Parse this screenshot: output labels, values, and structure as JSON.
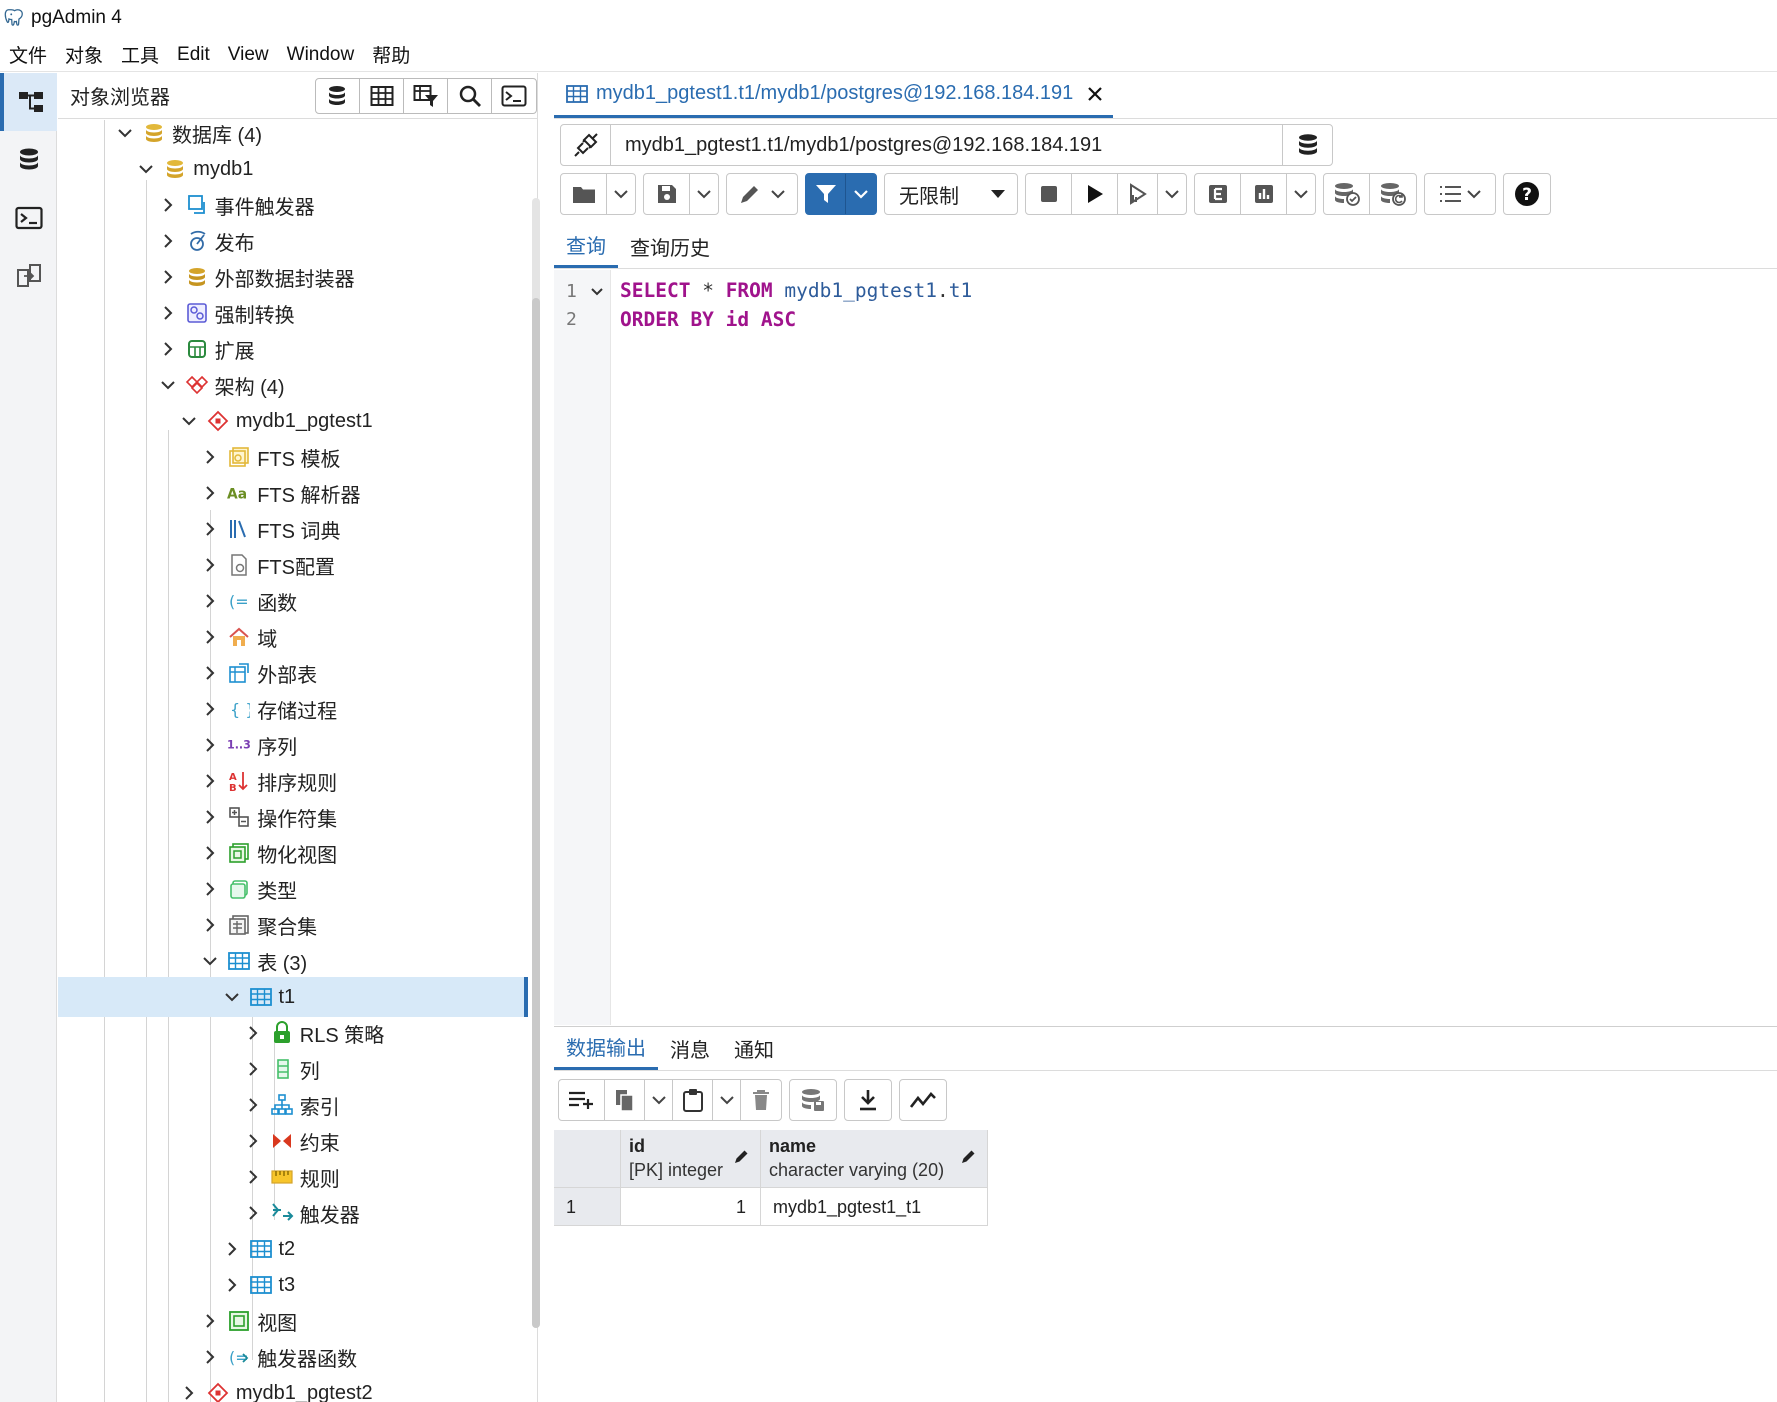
{
  "window": {
    "title": "pgAdmin 4"
  },
  "menubar": [
    "文件",
    "对象",
    "工具",
    "Edit",
    "View",
    "Window",
    "帮助"
  ],
  "browser": {
    "title": "对象浏览器",
    "tree": [
      {
        "label": "数据库 (4)",
        "depth": 0,
        "expanded": true,
        "icon": "database-icon"
      },
      {
        "label": "mydb1",
        "depth": 1,
        "expanded": true,
        "icon": "database-icon"
      },
      {
        "label": "事件触发器",
        "depth": 2,
        "expanded": false,
        "icon": "event-trigger-icon"
      },
      {
        "label": "发布",
        "depth": 2,
        "expanded": false,
        "icon": "publication-icon"
      },
      {
        "label": "外部数据封装器",
        "depth": 2,
        "expanded": false,
        "icon": "fdw-icon"
      },
      {
        "label": "强制转换",
        "depth": 2,
        "expanded": false,
        "icon": "cast-icon"
      },
      {
        "label": "扩展",
        "depth": 2,
        "expanded": false,
        "icon": "extension-icon"
      },
      {
        "label": "架构 (4)",
        "depth": 2,
        "expanded": true,
        "icon": "schemas-icon"
      },
      {
        "label": "mydb1_pgtest1",
        "depth": 3,
        "expanded": true,
        "icon": "schema-icon"
      },
      {
        "label": "FTS 模板",
        "depth": 4,
        "expanded": false,
        "icon": "fts-template-icon"
      },
      {
        "label": "FTS 解析器",
        "depth": 4,
        "expanded": false,
        "icon": "fts-parser-icon"
      },
      {
        "label": "FTS 词典",
        "depth": 4,
        "expanded": false,
        "icon": "fts-dictionary-icon"
      },
      {
        "label": "FTS配置",
        "depth": 4,
        "expanded": false,
        "icon": "fts-config-icon"
      },
      {
        "label": "函数",
        "depth": 4,
        "expanded": false,
        "icon": "function-icon"
      },
      {
        "label": "域",
        "depth": 4,
        "expanded": false,
        "icon": "domain-icon"
      },
      {
        "label": "外部表",
        "depth": 4,
        "expanded": false,
        "icon": "foreign-table-icon"
      },
      {
        "label": "存储过程",
        "depth": 4,
        "expanded": false,
        "icon": "procedure-icon"
      },
      {
        "label": "序列",
        "depth": 4,
        "expanded": false,
        "icon": "sequence-icon"
      },
      {
        "label": "排序规则",
        "depth": 4,
        "expanded": false,
        "icon": "collation-icon"
      },
      {
        "label": "操作符集",
        "depth": 4,
        "expanded": false,
        "icon": "operator-icon"
      },
      {
        "label": "物化视图",
        "depth": 4,
        "expanded": false,
        "icon": "mview-icon"
      },
      {
        "label": "类型",
        "depth": 4,
        "expanded": false,
        "icon": "type-icon"
      },
      {
        "label": "聚合集",
        "depth": 4,
        "expanded": false,
        "icon": "aggregate-icon"
      },
      {
        "label": "表 (3)",
        "depth": 4,
        "expanded": true,
        "icon": "tables-icon"
      },
      {
        "label": "t1",
        "depth": 5,
        "expanded": true,
        "icon": "table-icon",
        "selected": true
      },
      {
        "label": "RLS 策略",
        "depth": 6,
        "expanded": false,
        "icon": "rls-policy-icon"
      },
      {
        "label": "列",
        "depth": 6,
        "expanded": false,
        "icon": "columns-icon"
      },
      {
        "label": "索引",
        "depth": 6,
        "expanded": false,
        "icon": "index-icon"
      },
      {
        "label": "约束",
        "depth": 6,
        "expanded": false,
        "icon": "constraint-icon"
      },
      {
        "label": "规则",
        "depth": 6,
        "expanded": false,
        "icon": "rule-icon"
      },
      {
        "label": "触发器",
        "depth": 6,
        "expanded": false,
        "icon": "trigger-icon"
      },
      {
        "label": "t2",
        "depth": 5,
        "expanded": false,
        "icon": "table-icon"
      },
      {
        "label": "t3",
        "depth": 5,
        "expanded": false,
        "icon": "table-icon"
      },
      {
        "label": "视图",
        "depth": 4,
        "expanded": false,
        "icon": "view-icon"
      },
      {
        "label": "触发器函数",
        "depth": 4,
        "expanded": false,
        "icon": "trigger-function-icon"
      },
      {
        "label": "mydb1_pgtest2",
        "depth": 3,
        "expanded": false,
        "icon": "schema-icon"
      }
    ]
  },
  "query_tab": {
    "label": "mydb1_pgtest1.t1/mydb1/postgres@192.168.184.191",
    "connection": "mydb1_pgtest1.t1/mydb1/postgres@192.168.184.191",
    "limit": "无限制",
    "subtabs": [
      "查询",
      "查询历史"
    ],
    "active_subtab": "查询"
  },
  "editor": {
    "line_numbers": [
      "1",
      "2"
    ],
    "line1": {
      "kw1": "SELECT",
      "star": " * ",
      "kw2": "FROM",
      "ident": " mydb1_pgtest1",
      "dot": ".",
      "ident2": "t1"
    },
    "line2": {
      "kw1": "ORDER BY",
      "ident": " id",
      "kw2": " ASC"
    }
  },
  "results": {
    "tabs": [
      "数据输出",
      "消息",
      "通知"
    ],
    "active_tab": "数据输出",
    "columns": [
      {
        "name": "id",
        "type": "[PK] integer"
      },
      {
        "name": "name",
        "type": "character varying (20)"
      }
    ],
    "rows": [
      {
        "rownum": "1",
        "id": "1",
        "name": "mydb1_pgtest1_t1"
      }
    ]
  },
  "colors": {
    "accent": "#2a6cb0",
    "selected_row": "#d7e9f8",
    "keyword": "#a0138c",
    "identifier": "#2d5b9a"
  }
}
